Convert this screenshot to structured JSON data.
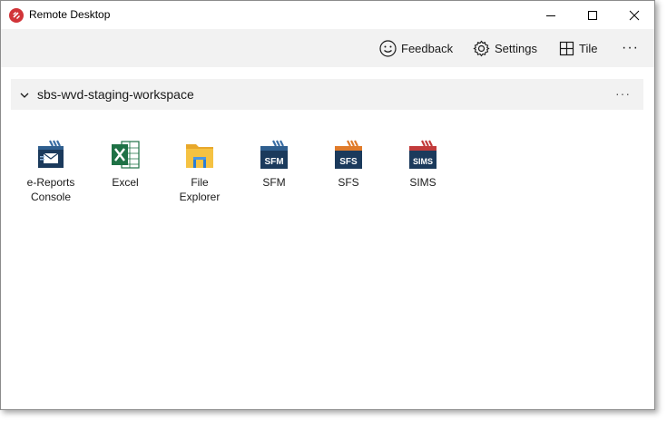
{
  "window": {
    "title": "Remote Desktop"
  },
  "titlebar_buttons": {
    "minimize_icon": "minimize-icon",
    "maximize_icon": "maximize-icon",
    "close_icon": "close-icon"
  },
  "toolbar": {
    "feedback_label": "Feedback",
    "settings_label": "Settings",
    "tile_label": "Tile",
    "more_label": "···"
  },
  "workspace": {
    "name": "sbs-wvd-staging-workspace",
    "more_label": "···"
  },
  "apps": [
    {
      "label": "e-Reports\nConsole",
      "icon": "e-reports-console-icon"
    },
    {
      "label": "Excel",
      "icon": "excel-icon"
    },
    {
      "label": "File\nExplorer",
      "icon": "file-explorer-icon"
    },
    {
      "label": "SFM",
      "icon": "sfm-icon"
    },
    {
      "label": "SFS",
      "icon": "sfs-icon"
    },
    {
      "label": "SIMS",
      "icon": "sims-icon"
    }
  ],
  "colors": {
    "toolbar_bg": "#f2f2f2",
    "accent_red": "#d13438",
    "excel_green": "#1e7145",
    "folder_yellow": "#f5c242",
    "capita_navy": "#1b3a5c"
  }
}
